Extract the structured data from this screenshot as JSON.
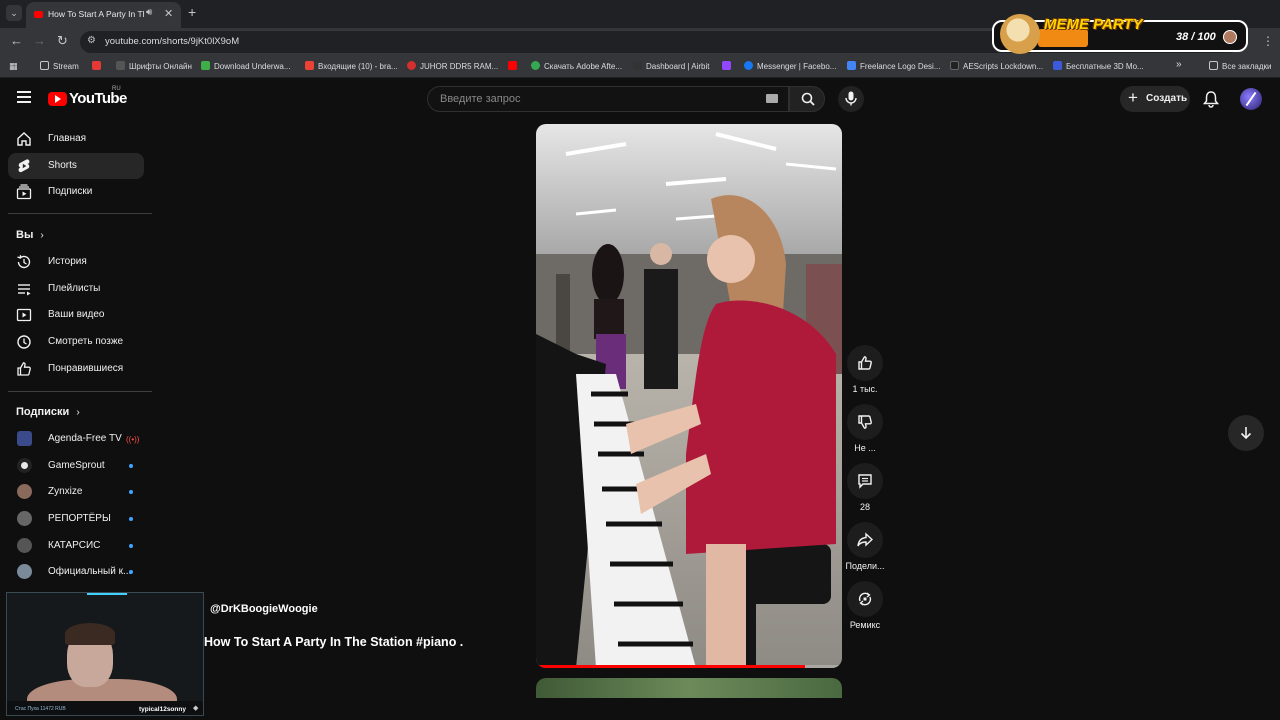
{
  "browser": {
    "tab_title": "How To Start A Party In The Station #piano",
    "url": "youtube.com/shorts/9jKt0lX9oM",
    "bookmarks": [
      {
        "label": "Stream",
        "color": "#8ab4f8"
      },
      {
        "label": "",
        "color": "#e53935"
      },
      {
        "label": "Шрифты Онлайн",
        "color": "#555555"
      },
      {
        "label": "Download Underwa...",
        "color": "#3fae49"
      },
      {
        "label": "Входящие (10) - bra...",
        "color": "#ea4335"
      },
      {
        "label": "JUHOR DDR5 RAM...",
        "color": "#d32f2f"
      },
      {
        "label": "",
        "color": "#ff0000"
      },
      {
        "label": "Скачать Adobe Afte...",
        "color": "#34a853"
      },
      {
        "label": "Dashboard | Airbit",
        "color": "#333333"
      },
      {
        "label": "",
        "color": "#9146ff"
      },
      {
        "label": "Messenger | Facebo...",
        "color": "#1877f2"
      },
      {
        "label": "Freelance Logo Desi...",
        "color": "#4285f4"
      },
      {
        "label": "AEScripts Lockdown...",
        "color": "#222222"
      },
      {
        "label": "Бесплатные 3D Mo...",
        "color": "#3b5bdb"
      }
    ],
    "all_bookmarks_label": "Все закладки"
  },
  "overlay": {
    "title": "MEME PARTY",
    "count": "38 / 100"
  },
  "masthead": {
    "logo_text": "YouTube",
    "country_code": "RU",
    "search_placeholder": "Введите запрос",
    "create_label": "Создать"
  },
  "sidebar": {
    "main": [
      {
        "label": "Главная",
        "icon": "home-icon"
      },
      {
        "label": "Shorts",
        "icon": "shorts-icon",
        "active": true
      },
      {
        "label": "Подписки",
        "icon": "subscriptions-icon"
      }
    ],
    "you_heading": "Вы",
    "you": [
      {
        "label": "История",
        "icon": "history-icon"
      },
      {
        "label": "Плейлисты",
        "icon": "playlists-icon"
      },
      {
        "label": "Ваши видео",
        "icon": "your-videos-icon"
      },
      {
        "label": "Смотреть позже",
        "icon": "watch-later-icon"
      },
      {
        "label": "Понравившиеся",
        "icon": "liked-icon"
      }
    ],
    "subs_heading": "Подписки",
    "subscriptions": [
      {
        "label": "Agenda-Free TV",
        "avatar": "#3b4a8a",
        "indicator": "live"
      },
      {
        "label": "GameSprout",
        "avatar": "#e8e8e8",
        "indicator": "dot"
      },
      {
        "label": "Zynxize",
        "avatar": "#8a6a5a",
        "indicator": "dot"
      },
      {
        "label": "РЕПОРТЁРЫ",
        "avatar": "#666666",
        "indicator": "dot"
      },
      {
        "label": "КАТАРСИС",
        "avatar": "#555555",
        "indicator": "dot"
      },
      {
        "label": "Официальный к...",
        "avatar": "#7a8a9a",
        "indicator": "dot"
      }
    ]
  },
  "short": {
    "channel": "@DrKBoogieWoogie",
    "title": "How To Start A Party In The Station #piano ...",
    "progress": 0.88,
    "actions": [
      {
        "label": "1 тыс.",
        "icon": "like-icon"
      },
      {
        "label": "Не ...",
        "icon": "dislike-icon"
      },
      {
        "label": "28",
        "icon": "comments-icon"
      },
      {
        "label": "Подели...",
        "icon": "share-icon"
      },
      {
        "label": "Ремикс",
        "icon": "remix-icon"
      }
    ]
  },
  "webcam": {
    "stream_label": "Стас Пуха 11472 RUB",
    "nick": "typical12sonny"
  }
}
